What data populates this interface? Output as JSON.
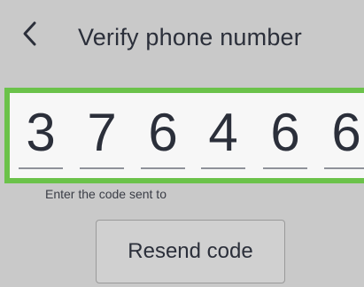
{
  "header": {
    "title": "Verify phone number",
    "back_icon": "chevron-left-icon"
  },
  "code": {
    "digits": [
      "3",
      "7",
      "6",
      "4",
      "6",
      "6"
    ]
  },
  "helper_text": "Enter the code sent to",
  "resend_button": {
    "label": "Resend code"
  },
  "colors": {
    "background": "#c9c9c9",
    "highlight_border": "#6bc24a",
    "code_box_background": "#f7f7f7",
    "text": "#2b2f3a"
  }
}
